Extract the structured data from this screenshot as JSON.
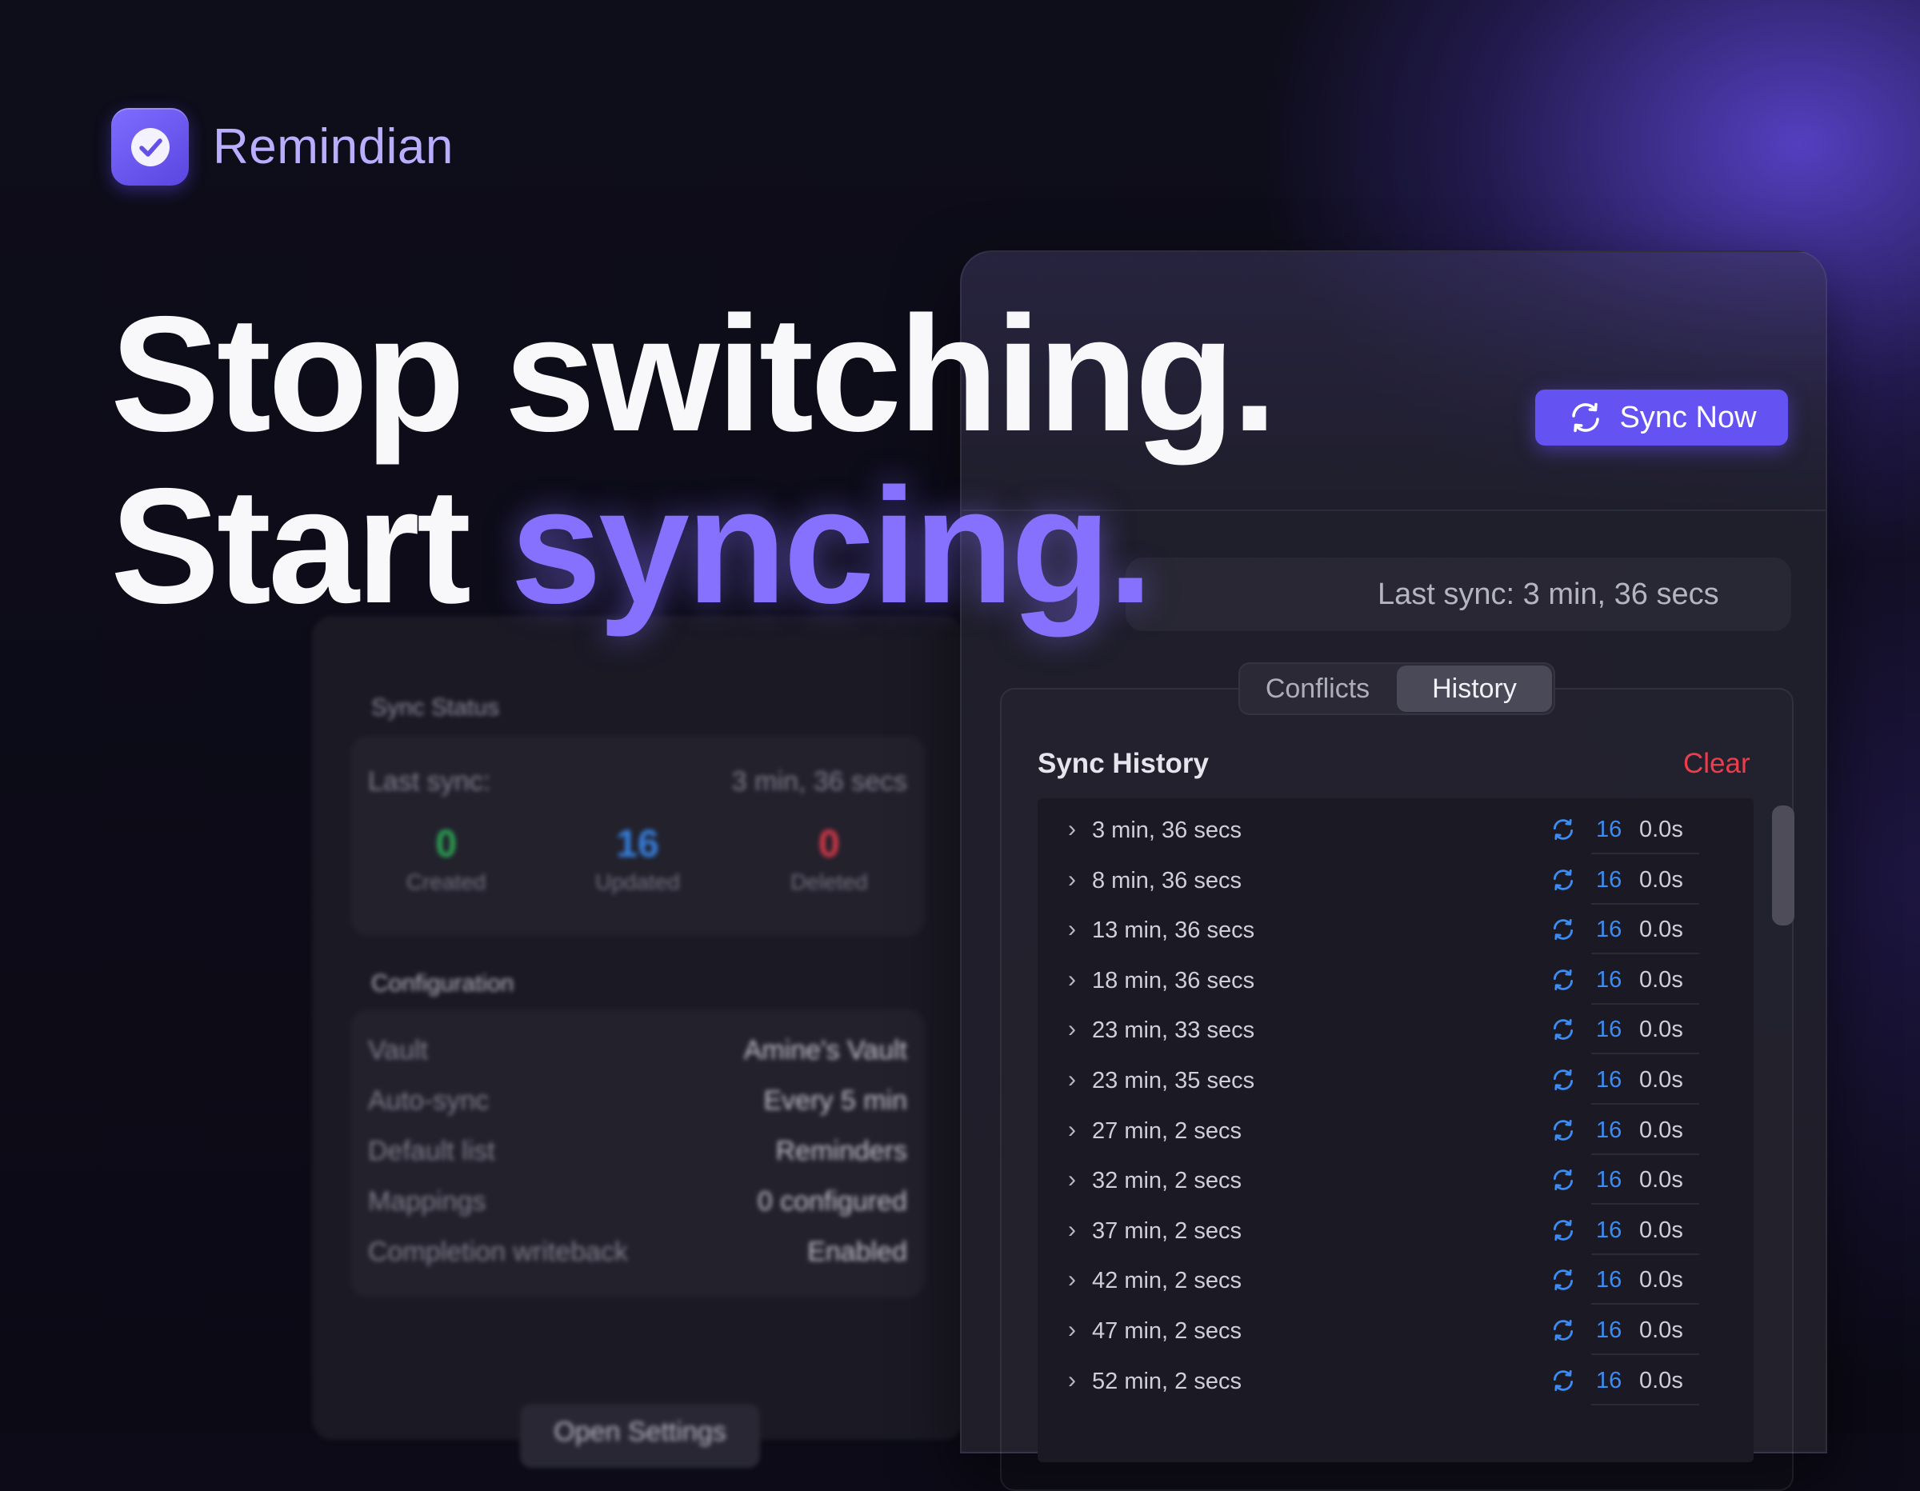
{
  "brand": {
    "name": "Remindian"
  },
  "headline": {
    "line1": "Stop switching.",
    "line2_start": "Start",
    "line2_accent": "syncing."
  },
  "colors": {
    "accent": "#6552f2",
    "created": "#2fb45a",
    "updated": "#3b8df5",
    "deleted": "#ec3d4d"
  },
  "status_panel": {
    "section_title": "Sync Status",
    "last_sync_label": "Last sync:",
    "last_sync_value": "3 min, 36 secs",
    "stats": [
      {
        "value": "0",
        "label": "Created"
      },
      {
        "value": "16",
        "label": "Updated"
      },
      {
        "value": "0",
        "label": "Deleted"
      }
    ],
    "config_title": "Configuration",
    "config": [
      {
        "key": "Vault",
        "value": "Amine's Vault"
      },
      {
        "key": "Auto-sync",
        "value": "Every 5 min"
      },
      {
        "key": "Default list",
        "value": "Reminders"
      },
      {
        "key": "Mappings",
        "value": "0 configured"
      },
      {
        "key": "Completion writeback",
        "value": "Enabled"
      }
    ],
    "open_settings": "Open Settings"
  },
  "sync_panel": {
    "sync_button": "Sync Now",
    "last_sync_text": "Last sync: 3 min, 36 secs",
    "tabs": [
      {
        "label": "Conflicts"
      },
      {
        "label": "History"
      }
    ],
    "active_tab": "History",
    "history_title": "Sync History",
    "clear_label": "Clear",
    "rows": [
      {
        "time": "3 min, 36 secs",
        "count": "16",
        "duration": "0.0s"
      },
      {
        "time": "8 min, 36 secs",
        "count": "16",
        "duration": "0.0s"
      },
      {
        "time": "13 min, 36 secs",
        "count": "16",
        "duration": "0.0s"
      },
      {
        "time": "18 min, 36 secs",
        "count": "16",
        "duration": "0.0s"
      },
      {
        "time": "23 min, 33 secs",
        "count": "16",
        "duration": "0.0s"
      },
      {
        "time": "23 min, 35 secs",
        "count": "16",
        "duration": "0.0s"
      },
      {
        "time": "27 min, 2 secs",
        "count": "16",
        "duration": "0.0s"
      },
      {
        "time": "32 min, 2 secs",
        "count": "16",
        "duration": "0.0s"
      },
      {
        "time": "37 min, 2 secs",
        "count": "16",
        "duration": "0.0s"
      },
      {
        "time": "42 min, 2 secs",
        "count": "16",
        "duration": "0.0s"
      },
      {
        "time": "47 min, 2 secs",
        "count": "16",
        "duration": "0.0s"
      },
      {
        "time": "52 min, 2 secs",
        "count": "16",
        "duration": "0.0s"
      }
    ]
  }
}
